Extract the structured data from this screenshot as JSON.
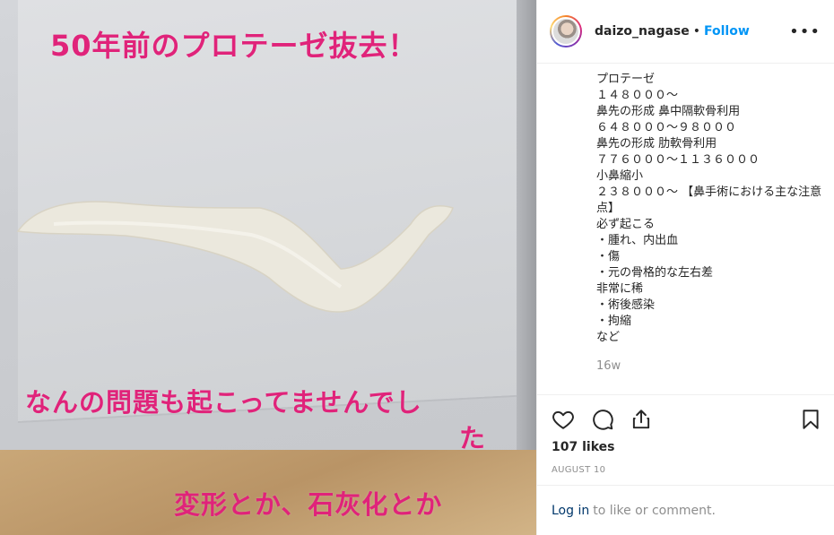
{
  "photo": {
    "overlay_line1": "50年前のプロテーゼ抜去！",
    "overlay_line2": "なんの問題も起こってませんでし",
    "overlay_line3": "た",
    "overlay_line4": "変形とか、石灰化とか",
    "overlay_color": "#e0237a"
  },
  "header": {
    "username": "daizo_nagase",
    "separator": "•",
    "follow_label": "Follow",
    "more_label": "•••"
  },
  "caption": {
    "text": "プロテーゼ\n１４８０００～\n鼻先の形成 鼻中隔軟骨利用\n６４８０００～９８０００\n鼻先の形成 肋軟骨利用\n７７６０００～１１３６０００\n小鼻縮小\n２３８０００～ 【鼻手術における主な注意点】\n必ず起こる\n・腫れ、内出血\n・傷\n・元の骨格的な左右差\n非常に稀\n・術後感染\n・拘縮\nなど"
  },
  "time_ago": "16w",
  "actions": {
    "like_icon": "heart-icon",
    "comment_icon": "comment-icon",
    "share_icon": "share-icon",
    "save_icon": "bookmark-icon"
  },
  "likes": "107 likes",
  "date": "AUGUST 10",
  "login": {
    "link_label": "Log in",
    "suffix": "to like or comment."
  },
  "colors": {
    "accent_blue": "#0095f6",
    "link_dark": "#00376b",
    "muted": "#8e8e8e",
    "text": "#262626"
  }
}
